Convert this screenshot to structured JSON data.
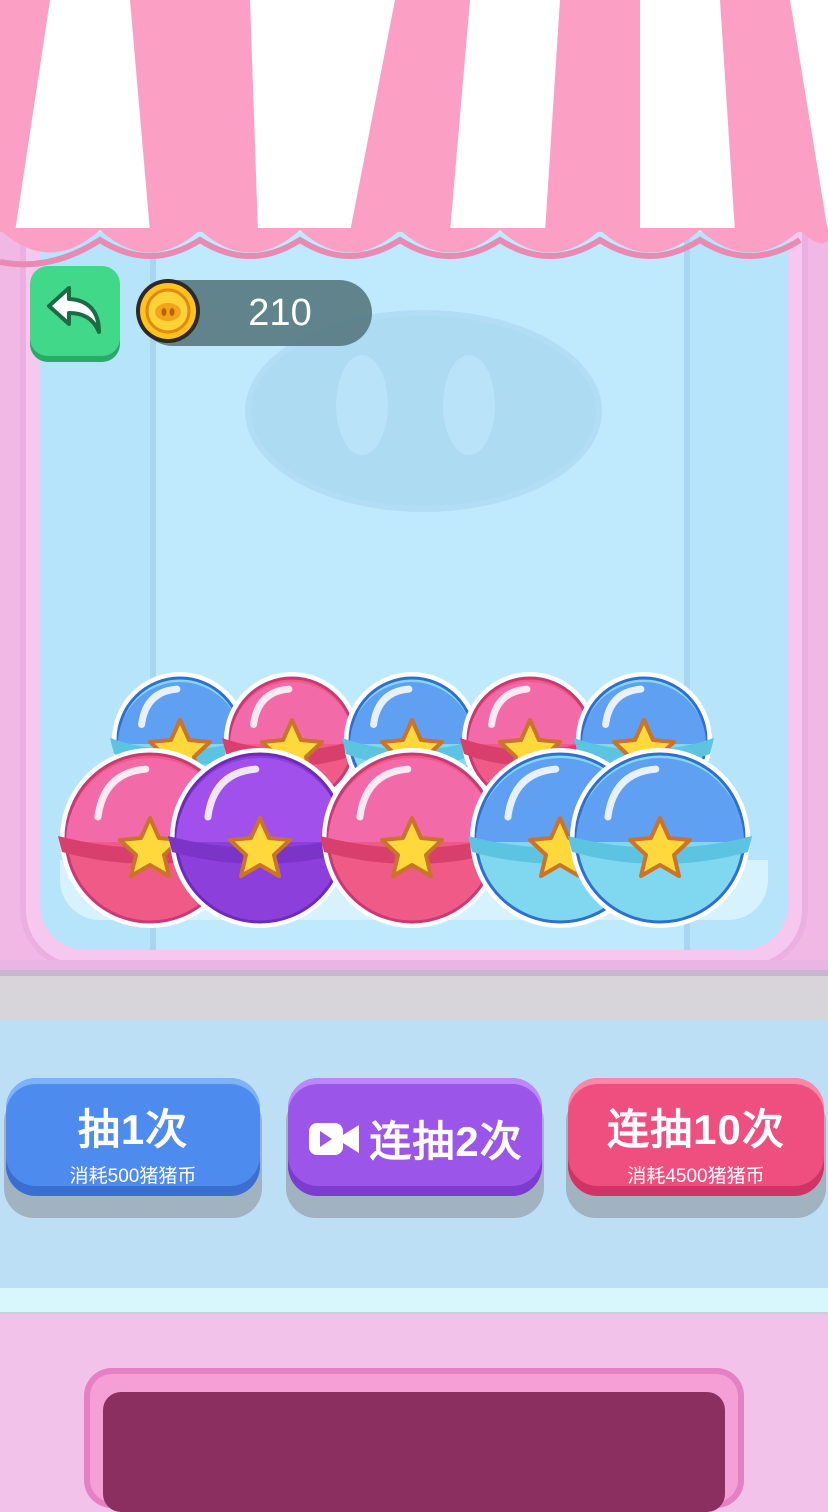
{
  "header": {
    "coin_balance": "210",
    "back_icon": "back-arrow-icon",
    "coin_icon": "pig-coin-icon"
  },
  "buttons": {
    "draw_one": {
      "label": "抽1次",
      "sub": "消耗500猪猪币",
      "color": "#4d8bee"
    },
    "draw_two": {
      "label": "连抽2次",
      "icon": "video-camera-icon",
      "color": "#9b55e8"
    },
    "draw_ten": {
      "label": "连抽10次",
      "sub": "消耗4500猪猪币",
      "color": "#ef4f7f"
    }
  },
  "capsules": {
    "back_row": [
      "blue",
      "pink",
      "blue",
      "pink",
      "blue"
    ],
    "front_row": [
      "pink",
      "purple",
      "pink",
      "blue",
      "blue"
    ]
  },
  "colors": {
    "awning_pink": "#fc9fc4",
    "awning_white": "#ffffff",
    "glass": "#b5e4fb",
    "back_button": "#42d889"
  }
}
